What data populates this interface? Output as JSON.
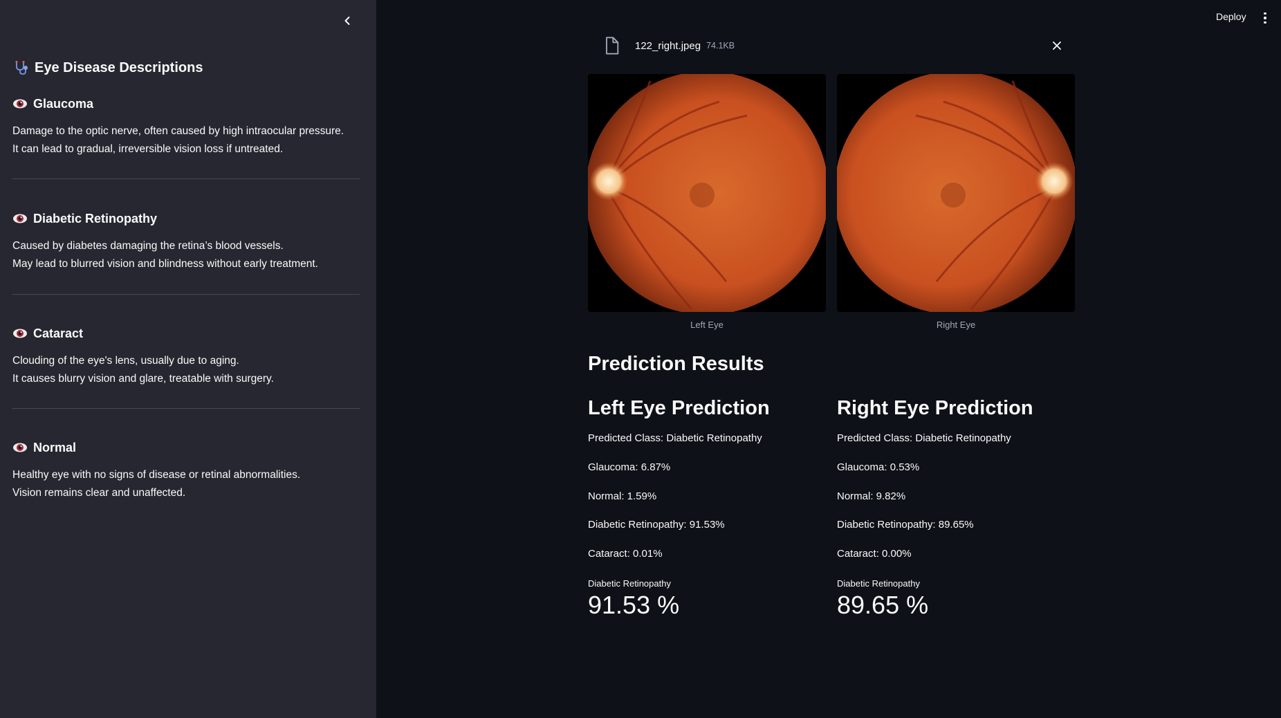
{
  "sidebar": {
    "title": "Eye Disease Descriptions",
    "sections": [
      {
        "heading": "Glaucoma",
        "lines": [
          "Damage to the optic nerve, often caused by high intraocular pressure.",
          "It can lead to gradual, irreversible vision loss if untreated."
        ]
      },
      {
        "heading": "Diabetic Retinopathy",
        "lines": [
          "Caused by diabetes damaging the retina’s blood vessels.",
          "May lead to blurred vision and blindness without early treatment."
        ]
      },
      {
        "heading": "Cataract",
        "lines": [
          "Clouding of the eye's lens, usually due to aging.",
          "It causes blurry vision and glare, treatable with surgery."
        ]
      },
      {
        "heading": "Normal",
        "lines": [
          "Healthy eye with no signs of disease or retinal abnormalities.",
          "Vision remains clear and unaffected."
        ]
      }
    ]
  },
  "header": {
    "deploy_label": "Deploy"
  },
  "upload": {
    "file_name": "122_right.jpeg",
    "file_size": "74.1KB"
  },
  "images": {
    "left_caption": "Left Eye",
    "right_caption": "Right Eye"
  },
  "results": {
    "title": "Prediction Results",
    "left": {
      "heading": "Left Eye Prediction",
      "predicted": "Predicted Class: Diabetic Retinopathy",
      "glaucoma": "Glaucoma: 6.87%",
      "normal": "Normal: 1.59%",
      "dr": "Diabetic Retinopathy: 91.53%",
      "cataract": "Cataract: 0.01%",
      "metric_label": "Diabetic Retinopathy",
      "metric_value": "91.53 %"
    },
    "right": {
      "heading": "Right Eye Prediction",
      "predicted": "Predicted Class: Diabetic Retinopathy",
      "glaucoma": "Glaucoma: 0.53%",
      "normal": "Normal: 9.82%",
      "dr": "Diabetic Retinopathy: 89.65%",
      "cataract": "Cataract: 0.00%",
      "metric_label": "Diabetic Retinopathy",
      "metric_value": "89.65 %"
    }
  },
  "icons": {
    "title": "stethoscope-icon",
    "section": "eye-icon",
    "file": "file-icon",
    "close": "close-icon",
    "collapse": "chevron-left-icon",
    "menu": "kebab-menu-icon"
  },
  "colors": {
    "sidebar_bg": "#262730",
    "main_bg": "#0e1117",
    "text": "#fafafa",
    "muted": "#a3a8b8",
    "fundus": "#d45a25"
  }
}
